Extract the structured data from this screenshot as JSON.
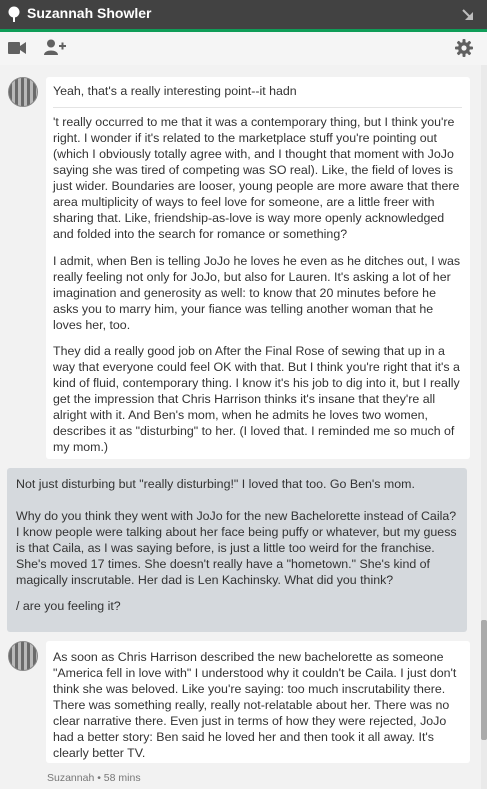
{
  "window": {
    "contact_name": "Suzannah Showler",
    "presence_icon": "map-pin-icon",
    "popout_icon": "arrow-down-right-icon"
  },
  "toolbar": {
    "video_icon": "video-call-icon",
    "add_person_icon": "add-person-icon",
    "settings_icon": "gear-icon"
  },
  "messages": [
    {
      "from": "incoming",
      "paragraphs": [
        "Yeah, that's a really interesting point--it hadn",
        "'t really occurred to me that it was a contemporary thing, but I think you're right. I wonder if it's related to the marketplace stuff you're pointing out (which I obviously totally agree with, and I thought that moment with JoJo saying she was tired of competing was SO real). Like, the field of loves is just wider. Boundaries are looser, young people are more aware that there area multiplicity of ways to feel love for someone, are a little freer with sharing that. Like, friendship-as-love is way more openly acknowledged and folded into the search for romance or something?",
        "I admit, when Ben is telling JoJo he loves he even as he ditches out, I was really feeling not only for JoJo, but also for Lauren. It's asking a lot of her imagination and generosity as well: to know that 20 minutes before he asks you to marry him, your fiance was telling another woman that he loves her, too.",
        "They did a really good job on After the Final Rose of sewing that up in a way that everyone could feel OK with that. But I think you're right that it's a kind of fluid, contemporary thing. I know it's his job to dig into it, but I really get the impression that Chris Harrison thinks it's insane that they're all alright with it. And Ben's mom, when he admits he loves two women, describes it as \"disturbing\" to her. (I loved that. I reminded me so much of my mom.)"
      ]
    },
    {
      "from": "outgoing",
      "paragraphs": [
        "Not just disturbing but \"really disturbing!\" I loved that too. Go Ben's mom.",
        "Why do you think they went with JoJo for the new Bachelorette instead of Caila? I know people were talking about her face being puffy or whatever, but my guess is that Caila, as I was saying before, is just a little too weird for the franchise. She's moved 17 times. She doesn't really have a \"hometown.\" She's kind of magically inscrutable. Her dad is Len Kachinsky. What did you think?",
        "/ are you feeling it?"
      ]
    },
    {
      "from": "incoming",
      "paragraphs": [
        "As soon as Chris Harrison described the new bachelorette as someone \"America fell in love with\" I understood why it couldn't be Caila. I just don't think she was beloved. Like you're saying: too much inscrutability there. There was something really, really not-relatable about her. There was no clear narrative there. Even just in terms of how they were rejected, JoJo had a better story: Ben said he loved her and then took it all away. It's clearly better TV."
      ]
    }
  ],
  "meta": {
    "last_message": "Suzannah • 58 mins"
  }
}
